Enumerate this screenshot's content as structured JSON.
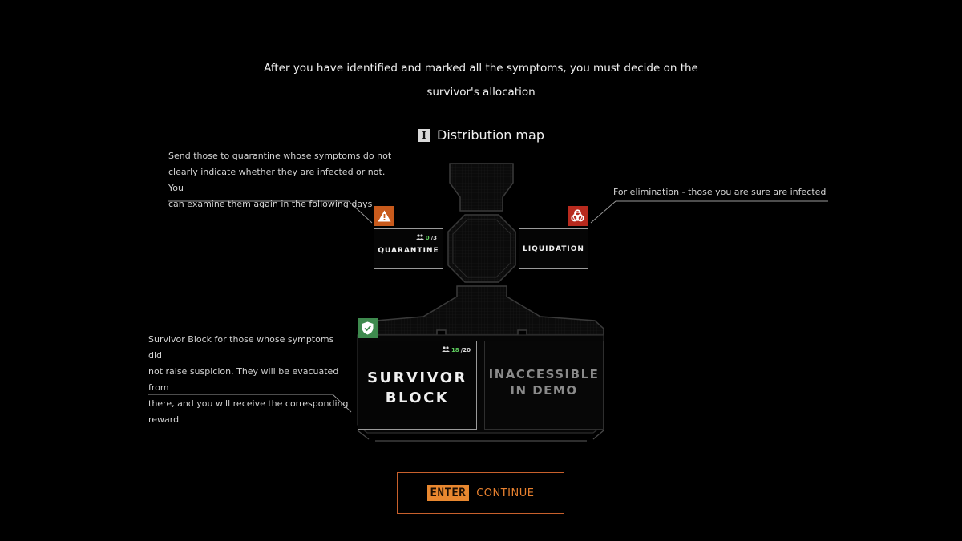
{
  "intro": {
    "line1": "After you have identified and marked all the symptoms, you must decide on the",
    "line2": "survivor's allocation"
  },
  "map_header": {
    "key": "I",
    "title": "Distribution map"
  },
  "notes": {
    "quarantine": {
      "line1": "Send those to quarantine whose symptoms do not",
      "line2": "clearly indicate whether they are infected or not. You",
      "line3": "can examine them again in the following days"
    },
    "liquidation": "For elimination - those you are sure are infected",
    "survivor": {
      "line1": "Survivor Block for those whose symptoms did",
      "line2": "not raise suspicion. They will be evacuated from",
      "line3": "there, and you will receive the corresponding",
      "line4": "reward"
    }
  },
  "rooms": {
    "quarantine": {
      "label": "QUARANTINE",
      "current": "0",
      "max": "/3",
      "badge_icon": "warning-icon",
      "badge_color": "#c85a1c"
    },
    "liquidation": {
      "label": "LIQUIDATION",
      "badge_icon": "biohazard-icon",
      "badge_color": "#b82a1e"
    },
    "survivor": {
      "label_line1": "SURVIVOR",
      "label_line2": "BLOCK",
      "current": "18",
      "max": "/20",
      "badge_icon": "shield-check-icon",
      "badge_color": "#3e8a4e"
    },
    "locked": {
      "label_line1": "INACCESSIBLE",
      "label_line2": "IN DEMO"
    }
  },
  "continue_button": {
    "key": "ENTER",
    "label": "CONTINUE",
    "accent": "#e8872f"
  }
}
